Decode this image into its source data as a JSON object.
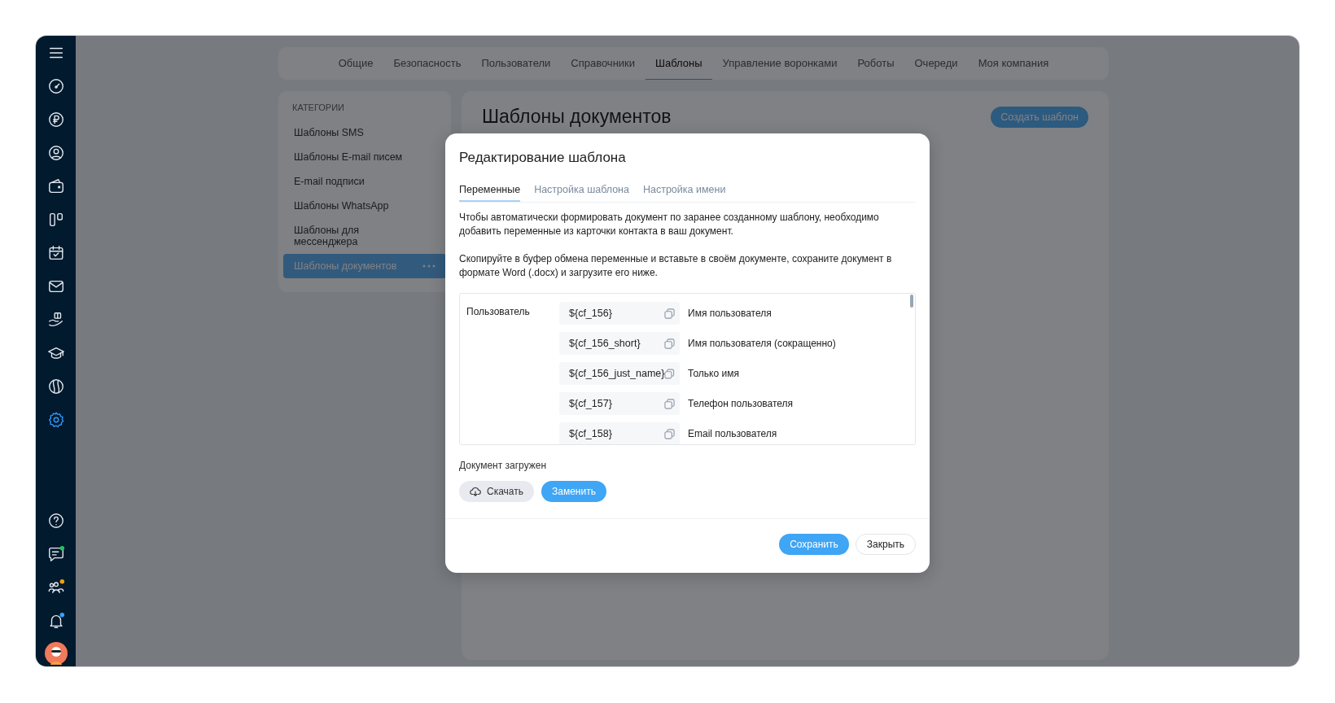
{
  "sidebar": {
    "items": [
      {
        "kind": "menu",
        "selected": false
      },
      {
        "kind": "gauge",
        "selected": false
      },
      {
        "kind": "ruble",
        "selected": false
      },
      {
        "kind": "user",
        "selected": false
      },
      {
        "kind": "wallet",
        "selected": false
      },
      {
        "kind": "board",
        "selected": false
      },
      {
        "kind": "calendar",
        "selected": false
      },
      {
        "kind": "mail",
        "selected": false
      },
      {
        "kind": "hand",
        "selected": false
      },
      {
        "kind": "cap",
        "selected": false
      },
      {
        "kind": "globe",
        "selected": false
      },
      {
        "kind": "settings",
        "selected": true
      }
    ],
    "bottom_items": [
      {
        "kind": "help"
      },
      {
        "kind": "chat",
        "color": "#22c55e"
      },
      {
        "kind": "team",
        "color": "#f59e0b"
      },
      {
        "kind": "bell",
        "color": "#3b9eff"
      },
      {
        "kind": "avatar"
      }
    ]
  },
  "top_tabs": [
    {
      "label": "Общие",
      "selected": false
    },
    {
      "label": "Безопасность",
      "selected": false
    },
    {
      "label": "Пользователи",
      "selected": false
    },
    {
      "label": "Справочники",
      "selected": false
    },
    {
      "label": "Шаблоны",
      "selected": true
    },
    {
      "label": "Управление воронками",
      "selected": false
    },
    {
      "label": "Роботы",
      "selected": false
    },
    {
      "label": "Очереди",
      "selected": false
    },
    {
      "label": "Моя компания",
      "selected": false
    }
  ],
  "categories": {
    "title": "КАТЕГОРИИ",
    "items": [
      {
        "label": "Шаблоны SMS",
        "selected": false
      },
      {
        "label": "Шаблоны E-mail писем",
        "selected": false
      },
      {
        "label": "E-mail подписи",
        "selected": false
      },
      {
        "label": "Шаблоны WhatsApp",
        "selected": false
      },
      {
        "label": "Шаблоны для мессенджера",
        "selected": false
      },
      {
        "label": "Шаблоны документов",
        "selected": true
      }
    ]
  },
  "page": {
    "title": "Шаблоны документов",
    "create_button": "Создать шаблон"
  },
  "modal": {
    "title": "Редактирование шаблона",
    "tabs": [
      {
        "label": "Переменные",
        "selected": true
      },
      {
        "label": "Настройка шаблона",
        "selected": false
      },
      {
        "label": "Настройка имени",
        "selected": false
      }
    ],
    "paragraphs": [
      "Чтобы автоматически формировать документ по заранее созданному шаблону, необходимо добавить переменные из карточки контакта в ваш документ.",
      "Скопируйте в буфер обмена переменные и вставьте в своём документе, сохраните документ в формате Word (.docx) и загрузите его ниже."
    ],
    "variables": {
      "group": "Пользователь",
      "rows": [
        {
          "code": "${cf_156}",
          "description": "Имя пользователя"
        },
        {
          "code": "${cf_156_short}",
          "description": "Имя пользователя (сокращенно)"
        },
        {
          "code": "${cf_156_just_name}",
          "description": "Только имя"
        },
        {
          "code": "${cf_157}",
          "description": "Телефон пользователя"
        },
        {
          "code": "${cf_158}",
          "description": "Email пользователя"
        }
      ]
    },
    "upload_status": "Документ загружен",
    "download_button": "Скачать",
    "replace_button": "Заменить",
    "save_button": "Сохранить",
    "close_button": "Закрыть"
  }
}
